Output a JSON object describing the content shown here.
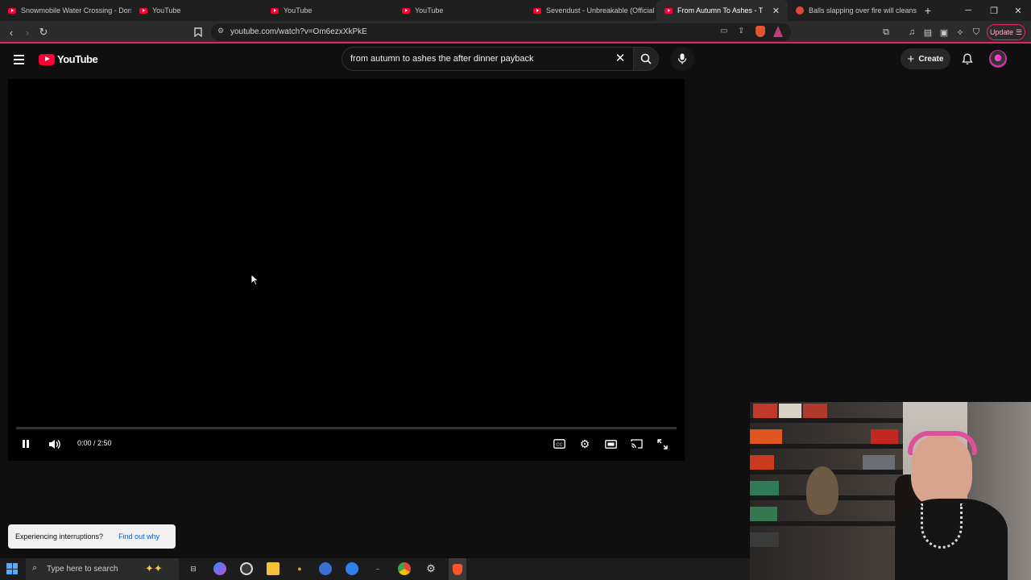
{
  "browser": {
    "tabs": [
      {
        "title": "Snowmobile Water Crossing - Dorset",
        "active": false
      },
      {
        "title": "YouTube",
        "active": false
      },
      {
        "title": "YouTube",
        "active": false
      },
      {
        "title": "YouTube",
        "active": false
      },
      {
        "title": "Sevendust - Unbreakable (Official Vi",
        "active": false
      },
      {
        "title": "From Autumn To Ashes - The Af",
        "active": true
      },
      {
        "title": "Balls slapping over fire will cleanse y",
        "active": false
      }
    ],
    "new_tab": "+",
    "url": "youtube.com/watch?v=Om6ezxXkPkE",
    "update_label": "Update",
    "accent_color": "#e6245e"
  },
  "youtube": {
    "logo_text": "YouTube",
    "search_query": "from autumn to ashes the after dinner payback",
    "create_label": "Create"
  },
  "player": {
    "state": "playing",
    "time_current": "0:00",
    "time_total": "2:50",
    "time_display": "0:00 / 2:50",
    "progress": 0
  },
  "toast": {
    "message": "Experiencing interruptions?",
    "link": "Find out why"
  },
  "taskbar": {
    "search_placeholder": "Type here to search"
  }
}
